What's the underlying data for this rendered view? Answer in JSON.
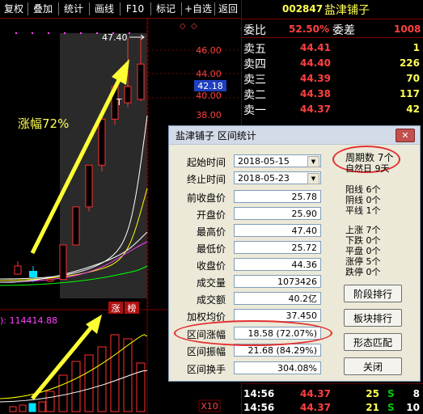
{
  "toolbar": {
    "items": [
      "复权",
      "叠加",
      "统计",
      "画线",
      "F10",
      "标记",
      "+自选",
      "返回"
    ]
  },
  "chart": {
    "price_axis": [
      "46.00",
      "44.00",
      "42.18",
      "40.00",
      "38.00"
    ],
    "high_label": "47.40",
    "gain_annotation": "涨幅72%",
    "limit_up_marks": [
      "涨",
      "榜"
    ],
    "volume_label": "): 114414.88",
    "scale_label": "X10",
    "colors": {
      "up": "#ff3030",
      "ma5": "#ffffff",
      "ma10": "#ffff00",
      "ma20": "#ff40ff",
      "ma60": "#00ff00",
      "arrow": "#ffff33"
    },
    "candles": [
      {
        "o": 25.78,
        "c": 25.9,
        "h": 25.95,
        "l": 25.72
      },
      {
        "o": 25.9,
        "c": 28.49,
        "h": 28.49,
        "l": 25.9
      },
      {
        "o": 28.49,
        "c": 31.34,
        "h": 31.34,
        "l": 28.49
      },
      {
        "o": 31.34,
        "c": 34.47,
        "h": 34.47,
        "l": 31.0
      },
      {
        "o": 34.47,
        "c": 37.92,
        "h": 37.92,
        "l": 34.0
      },
      {
        "o": 37.92,
        "c": 41.71,
        "h": 41.71,
        "l": 37.5
      },
      {
        "o": 41.71,
        "c": 39.8,
        "h": 47.4,
        "l": 39.3
      },
      {
        "o": 40.2,
        "c": 44.36,
        "h": 47.4,
        "l": 40.0
      }
    ],
    "volumes": [
      0.25,
      0.45,
      0.62,
      0.7,
      0.8,
      0.95,
      0.9,
      0.6
    ]
  },
  "quote": {
    "code": "002847",
    "name": "盐津铺子",
    "weibi_label": "委比",
    "weibi_value": "52.50%",
    "weicha_label": "委差",
    "weicha_value": "1008",
    "asks": [
      {
        "label": "卖五",
        "price": "44.41",
        "vol": "1"
      },
      {
        "label": "卖四",
        "price": "44.40",
        "vol": "226"
      },
      {
        "label": "卖三",
        "price": "44.39",
        "vol": "70"
      },
      {
        "label": "卖二",
        "price": "44.38",
        "vol": "117"
      },
      {
        "label": "卖一",
        "price": "44.37",
        "vol": "42"
      }
    ],
    "ticks": [
      {
        "time": "14:56",
        "price": "44.37",
        "vol": "25",
        "flag": "S",
        "n": "8"
      },
      {
        "time": "14:56",
        "price": "44.37",
        "vol": "21",
        "flag": "S",
        "n": "10"
      }
    ]
  },
  "dialog": {
    "title": "盐津铺子 区间统计",
    "close": "✕",
    "start_label": "起始时间",
    "start_value": "2018-05-15",
    "end_label": "终止时间",
    "end_value": "2018-05-23",
    "rows": [
      {
        "label": "前收盘价",
        "value": "25.78"
      },
      {
        "label": "开盘价",
        "value": "25.90"
      },
      {
        "label": "最高价",
        "value": "47.40"
      },
      {
        "label": "最低价",
        "value": "25.72"
      },
      {
        "label": "收盘价",
        "value": "44.36"
      },
      {
        "label": "成交量",
        "value": "1073426"
      },
      {
        "label": "成交额",
        "value": "40.2亿"
      },
      {
        "label": "加权均价",
        "value": "37.450"
      },
      {
        "label": "区间涨幅",
        "value": "18.58 (72.07%)"
      },
      {
        "label": "区间振幅",
        "value": "21.68 (84.29%)"
      },
      {
        "label": "区间换手",
        "value": "304.08%"
      }
    ],
    "period_count": "周期数  7个",
    "natural_days": "自然日  9天",
    "stats1": [
      {
        "label": "阳线",
        "value": "6个"
      },
      {
        "label": "阴线",
        "value": "0个"
      },
      {
        "label": "平线",
        "value": "1个"
      }
    ],
    "stats2": [
      {
        "label": "上涨",
        "value": "7个"
      },
      {
        "label": "下跌",
        "value": "0个"
      },
      {
        "label": "平盘",
        "value": "0个"
      },
      {
        "label": "涨停",
        "value": "5个"
      },
      {
        "label": "跌停",
        "value": "0个"
      }
    ],
    "buttons": [
      "阶段排行",
      "板块排行",
      "形态匹配",
      "关闭"
    ]
  }
}
